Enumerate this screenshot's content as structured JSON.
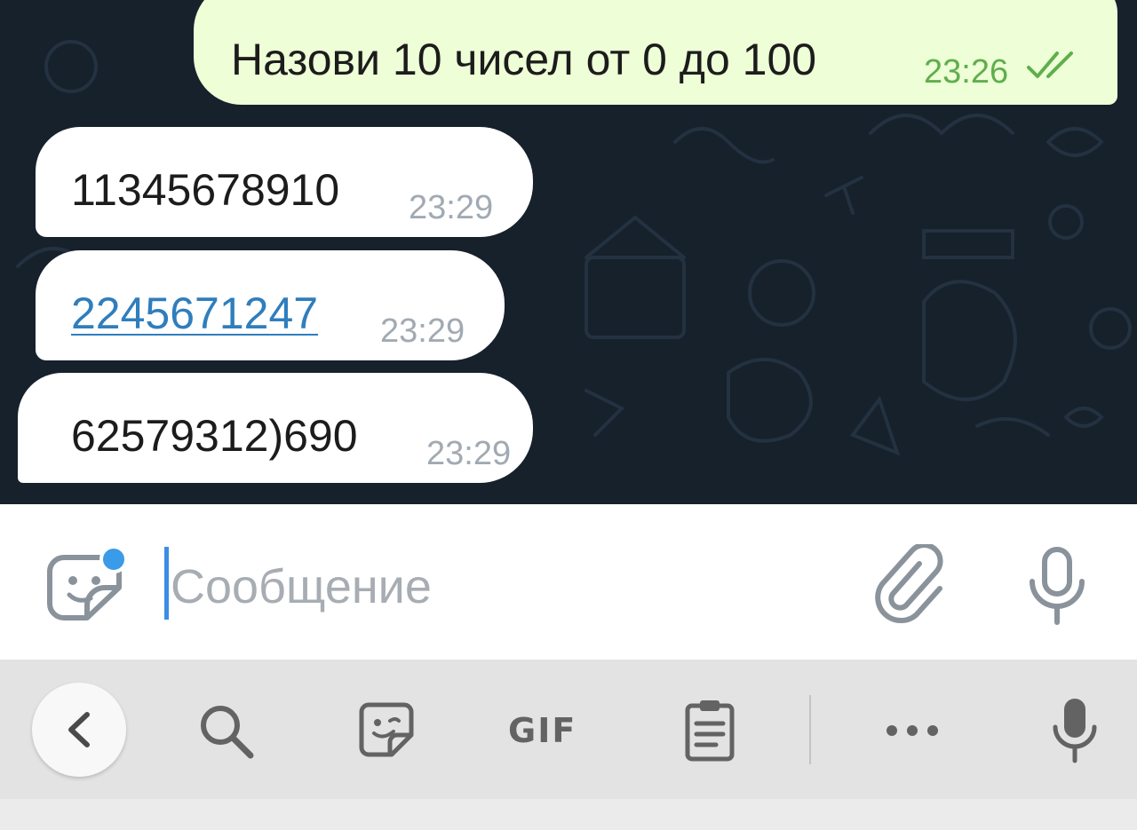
{
  "messages": [
    {
      "direction": "outgoing",
      "text": "Назови 10 чисел от 0 до 100",
      "time": "23:26",
      "status": "read"
    },
    {
      "direction": "incoming",
      "text": "11345678910",
      "time": "23:29"
    },
    {
      "direction": "incoming",
      "text": "2245671247",
      "time": "23:29",
      "is_link": true
    },
    {
      "direction": "incoming",
      "text": "62579312)690",
      "time": "23:29"
    }
  ],
  "composer": {
    "placeholder": "Сообщение",
    "value": "",
    "icons": [
      "sticker-emoji-icon",
      "attach-paperclip-icon",
      "microphone-icon"
    ]
  },
  "keyboard_toolbar": {
    "gif_label": "GIF",
    "icons": [
      "chevron-left-icon",
      "search-icon",
      "sticker-icon",
      "clipboard-icon",
      "more-dots-icon",
      "voice-input-icon"
    ]
  },
  "colors": {
    "chat_background": "#16212c",
    "outgoing_bubble": "#eefed7",
    "incoming_bubble": "#ffffff",
    "outgoing_time": "#5fae4c",
    "link": "#2f7ebd",
    "accent": "#3a8ee6"
  }
}
